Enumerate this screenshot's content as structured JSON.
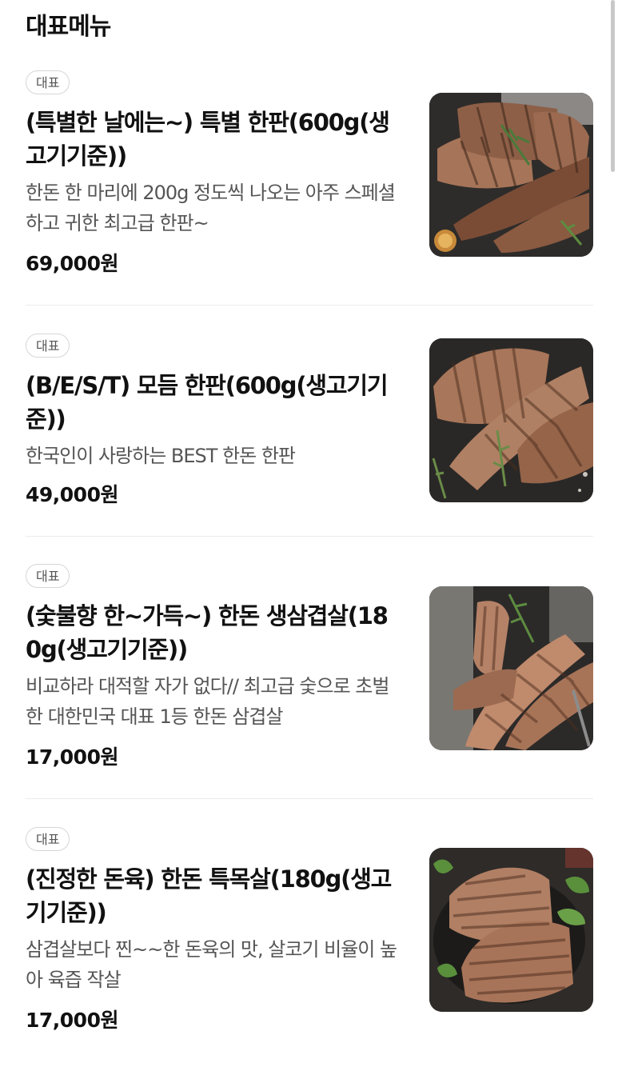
{
  "section_title": "대표메뉴",
  "items": [
    {
      "badge": "대표",
      "name": "(특별한 날에는~) 특별 한판(600g(생고기기준))",
      "description": "한돈 한 마리에 200g 정도씩 나오는 아주 스페셜하고 귀한 최고급 한판~",
      "price": "69,000원",
      "image_icon": "grilled-pork-platter-photo"
    },
    {
      "badge": "대표",
      "name": "(B/E/S/T) 모듬 한판(600g(생고기기준))",
      "description": "한국인이 사랑하는 BEST 한돈 한판",
      "price": "49,000원",
      "image_icon": "grilled-pork-platter-photo"
    },
    {
      "badge": "대표",
      "name": "(숯불향 한~가득~) 한돈 생삼겹살(180g(생고기기준))",
      "description": "비교하라 대적할 자가 없다// 최고급 숯으로 초벌한 대한민국 대표 1등 한돈 삼겹살",
      "price": "17,000원",
      "image_icon": "grilled-pork-belly-photo"
    },
    {
      "badge": "대표",
      "name": "(진정한 돈육) 한돈 특목살(180g(생고기기준))",
      "description": "삼겹살보다 찐~~한 돈육의 맛, 살코기 비율이 높아 육즙 작살",
      "price": "17,000원",
      "image_icon": "grilled-pork-neck-photo"
    }
  ]
}
